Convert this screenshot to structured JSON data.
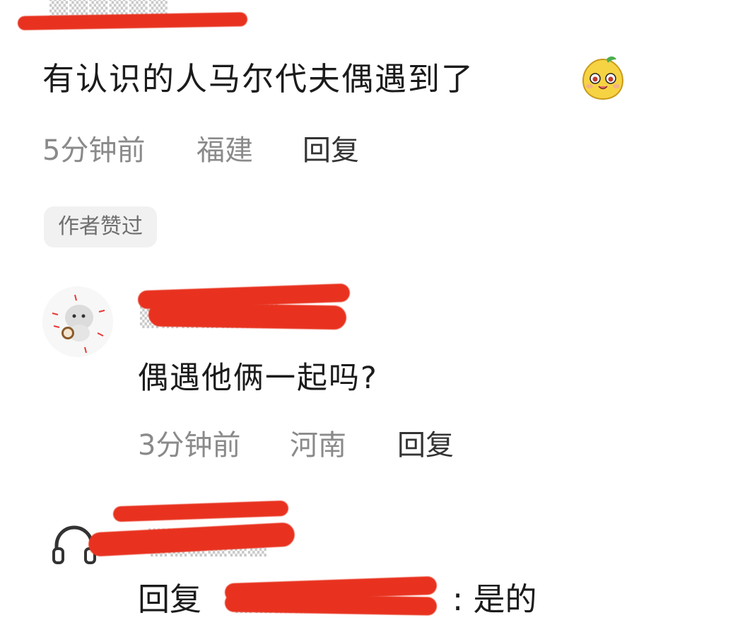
{
  "comment": {
    "text": "有认识的人马尔代夫偶遇到了",
    "emoji": "smiling-face-emoji",
    "time": "5分钟前",
    "location": "福建",
    "reply_label": "回复",
    "badge": "作者赞过"
  },
  "reply_one": {
    "text": "偶遇他俩一起吗?",
    "time": "3分钟前",
    "location": "河南",
    "reply_label": "回复"
  },
  "reply_two": {
    "prefix": "回复",
    "text": ": 是的"
  },
  "colors": {
    "redaction": "#e8321f",
    "meta_gray": "#8a8a8a",
    "badge_bg": "#f1f1f1"
  }
}
